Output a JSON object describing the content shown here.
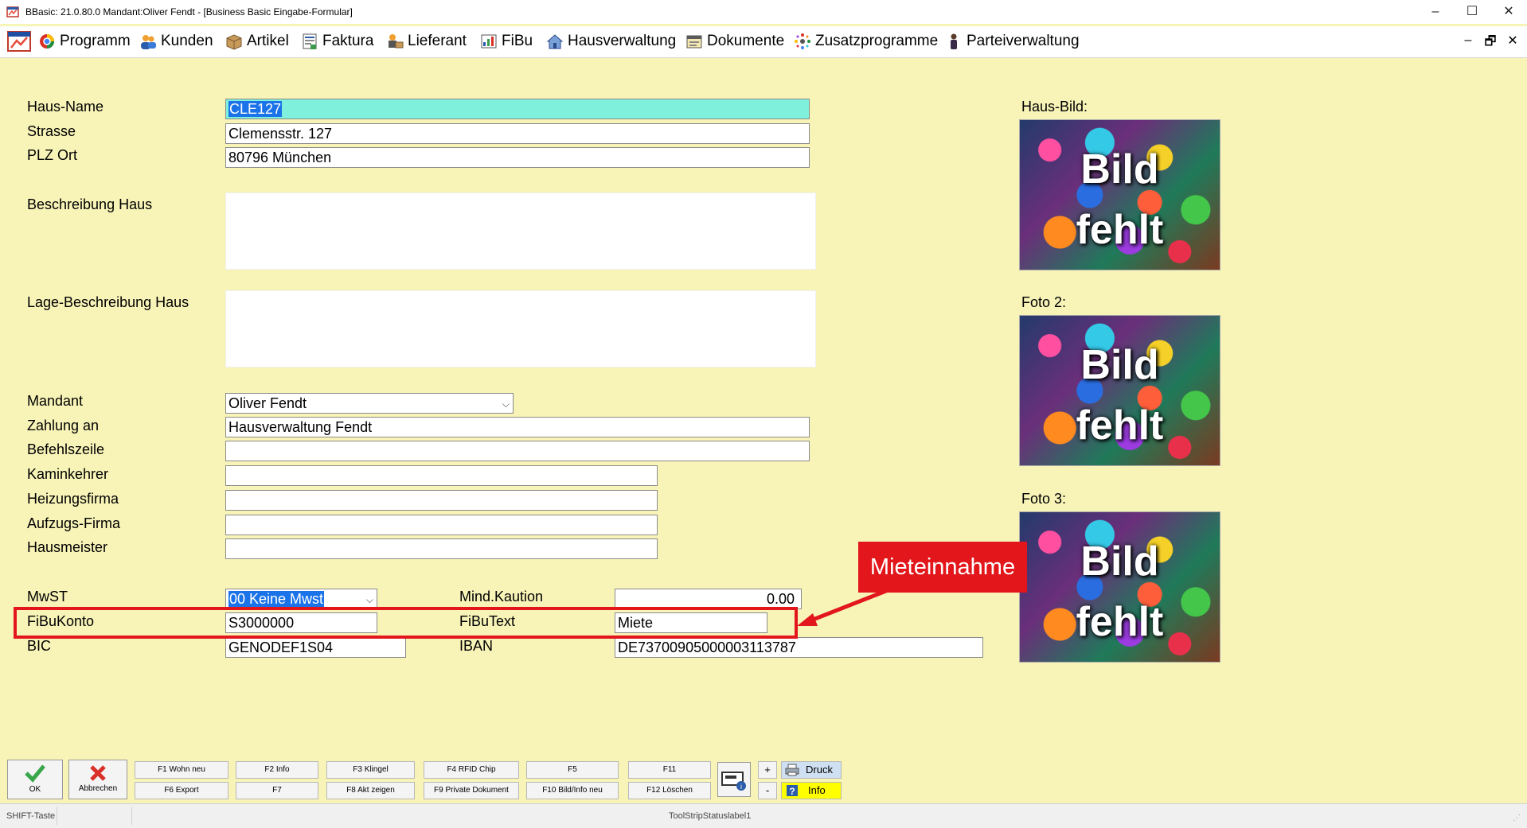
{
  "window": {
    "title": "BBasic: 21.0.80.0 Mandant:Oliver Fendt  - [Business Basic Eingabe-Formular]",
    "minimize": "–",
    "maximize": "☐",
    "close": "✕"
  },
  "menu": {
    "items": [
      {
        "label": "Programm"
      },
      {
        "label": "Kunden"
      },
      {
        "label": "Artikel"
      },
      {
        "label": "Faktura"
      },
      {
        "label": "Lieferant"
      },
      {
        "label": "FiBu"
      },
      {
        "label": "Hausverwaltung"
      },
      {
        "label": "Dokumente"
      },
      {
        "label": "Zusatzprogramme"
      },
      {
        "label": "Parteiverwaltung"
      }
    ],
    "mdi_minimize": "–",
    "mdi_restore": "🗗",
    "mdi_close": "✕"
  },
  "form": {
    "haus_name": {
      "label": "Haus-Name",
      "value": "CLE127"
    },
    "strasse": {
      "label": "Strasse",
      "value": "Clemensstr. 127"
    },
    "plz_ort": {
      "label": "PLZ Ort",
      "value": "80796 München"
    },
    "beschreibung": {
      "label": "Beschreibung Haus",
      "value": ""
    },
    "lage": {
      "label": "Lage-Beschreibung Haus",
      "value": ""
    },
    "mandant": {
      "label": "Mandant",
      "value": "Oliver Fendt"
    },
    "zahlung_an": {
      "label": "Zahlung an",
      "value": "Hausverwaltung Fendt"
    },
    "befehlszeile": {
      "label": "Befehlszeile",
      "value": ""
    },
    "kaminkehrer": {
      "label": "Kaminkehrer",
      "value": ""
    },
    "heizungsfirma": {
      "label": "Heizungsfirma",
      "value": ""
    },
    "aufzugsfirma": {
      "label": "Aufzugs-Firma",
      "value": ""
    },
    "hausmeister": {
      "label": "Hausmeister",
      "value": ""
    },
    "mwst": {
      "label": "MwST",
      "value": "00 Keine Mwst"
    },
    "mind_kaution": {
      "label": "Mind.Kaution",
      "value": "0.00"
    },
    "fibukonto": {
      "label": "FiBuKonto",
      "value": "S3000000"
    },
    "fibutext": {
      "label": "FiBuText",
      "value": "Miete"
    },
    "bic": {
      "label": "BIC",
      "value": "GENODEF1S04"
    },
    "iban": {
      "label": "IBAN",
      "value": "DE73700905000003113787"
    }
  },
  "images": {
    "haus_bild": {
      "label": "Haus-Bild:",
      "line1": "Bild",
      "line2": "fehlt"
    },
    "foto2": {
      "label": "Foto 2:",
      "line1": "Bild",
      "line2": "fehlt"
    },
    "foto3": {
      "label": "Foto 3:",
      "line1": "Bild",
      "line2": "fehlt"
    }
  },
  "annotation": {
    "callout": "Mieteinnahme",
    "color": "#e2161b"
  },
  "toolbar": {
    "ok": "OK",
    "abbrechen": "Abbrechen",
    "fkeys_top": [
      "F1 Wohn neu",
      "F2 Info",
      "F3 Klingel",
      "F4 RFID Chip",
      "F5",
      "F11"
    ],
    "fkeys_bottom": [
      "F6 Export",
      "F7",
      "F8 Akt zeigen",
      "F9 Private Dokument",
      "F10 Bild/Info neu",
      "F12 Löschen"
    ],
    "plus": "+",
    "minus": "-",
    "druck": "Druck",
    "info": "Info"
  },
  "statusbar": {
    "shift": "SHIFT-Taste",
    "label": "ToolStripStatuslabel1"
  },
  "colors": {
    "background": "#f8f4b8",
    "highlight_field": "#7ff0dc",
    "selection": "#1a73e8",
    "info_button": "#ffff00"
  }
}
